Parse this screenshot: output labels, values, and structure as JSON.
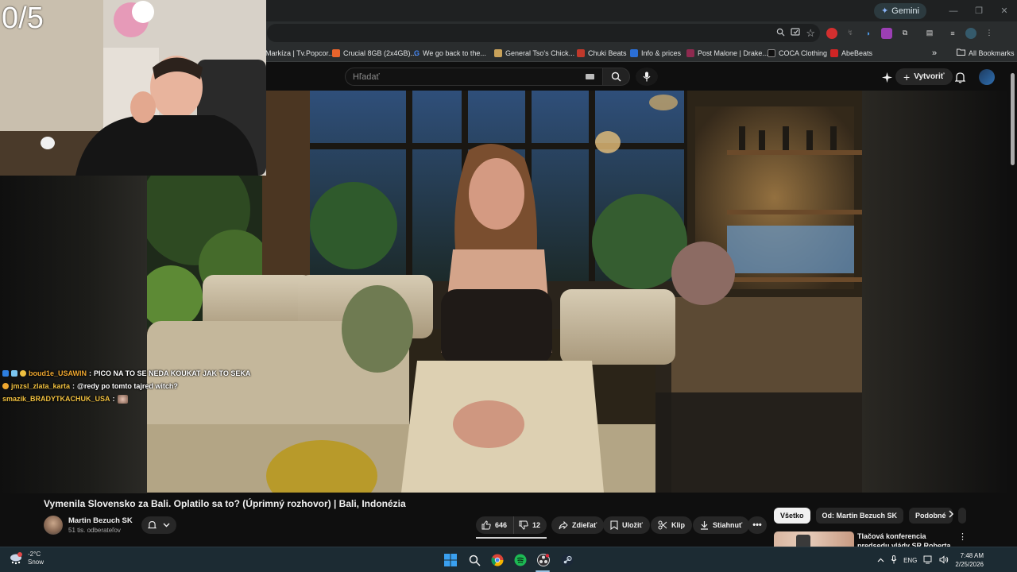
{
  "browser": {
    "gemini_label": "Gemini",
    "bookmarks": [
      {
        "label": "Markíza | Tv.Popcor...",
        "color": "#2a2d2e"
      },
      {
        "label": "Crucial 8GB (2x4GB)...",
        "color": "#e8642c"
      },
      {
        "label": "We go back to the...",
        "color": "#4285f4"
      },
      {
        "label": "General Tso's Chick...",
        "color": "#c9a25a"
      },
      {
        "label": "Chuki Beats",
        "color": "#c0392b"
      },
      {
        "label": "Info & prices",
        "color": "#2b6fd6"
      },
      {
        "label": "Post Malone | Drake...",
        "color": "#8e2a4f"
      },
      {
        "label": "COCA Clothing",
        "color": "#111111"
      },
      {
        "label": "AbeBeats",
        "color": "#d02525"
      }
    ],
    "all_bookmarks": "All Bookmarks",
    "overflow": "»"
  },
  "stream": {
    "counter": "0/5",
    "chat": [
      {
        "user": "boud1e_USAWIN",
        "user_color": "#f0a830",
        "sep": " :",
        "message": "PICO NA TO SE NEDA KOUKAT JAK TO SEKA"
      },
      {
        "user": "jmzsl_zlata_karta",
        "user_color": "#f0c040",
        "sep": " :",
        "message": "@redy po tomto tajred witch?"
      },
      {
        "user": "smazik_BRADYTKACHUK_USA",
        "user_color": "#f0c040",
        "sep": " :",
        "message": ""
      }
    ]
  },
  "youtube": {
    "search_placeholder": "Hľadať",
    "create_label": "Vytvoriť",
    "video_title": "Vymenila Slovensko za Bali. Oplatilo sa to? (Úprimný rozhovor) | Bali, Indonézia",
    "channel_name": "Martin Bezuch SK",
    "subscribers": "51 tis. odberateľov",
    "likes": "646",
    "dislikes": "12",
    "share_label": "Zdieľať",
    "save_label": "Uložiť",
    "clip_label": "Klip",
    "download_label": "Stiahnuť",
    "chips": [
      "Všetko",
      "Od: Martin Bezuch SK",
      "Podobné"
    ],
    "recommended_title": "Tlačová konferencia predsedu vlády SR Roberta Fica po"
  },
  "taskbar": {
    "temperature": "-2°C",
    "weather": "Snow",
    "language": "ENG",
    "time": "7:48 AM",
    "date": "2/25/2026"
  }
}
